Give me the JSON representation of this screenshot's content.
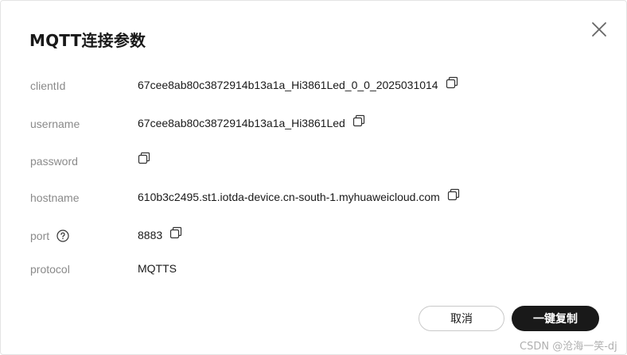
{
  "dialog": {
    "title": "MQTT连接参数",
    "close_icon": "close-icon"
  },
  "fields": {
    "clientId": {
      "label": "clientId",
      "value": "67cee8ab80c3872914b13a1a_Hi3861Led_0_0_2025031014"
    },
    "username": {
      "label": "username",
      "value": "67cee8ab80c3872914b13a1a_Hi3861Led"
    },
    "password": {
      "label": "password",
      "value": ""
    },
    "hostname": {
      "label": "hostname",
      "value": "610b3c2495.st1.iotda-device.cn-south-1.myhuaweicloud.com"
    },
    "port": {
      "label": "port",
      "value": "8883",
      "help_icon": "question-circle-icon"
    },
    "protocol": {
      "label": "protocol",
      "value": "MQTTS"
    }
  },
  "buttons": {
    "cancel": "取消",
    "copy_all": "一键复制"
  },
  "watermark": "CSDN @沧海一笑-dj",
  "icons": {
    "copy": "copy-icon"
  },
  "colors": {
    "primary": "#191919",
    "label": "#8a8a8a",
    "text": "#1a1a1a"
  }
}
